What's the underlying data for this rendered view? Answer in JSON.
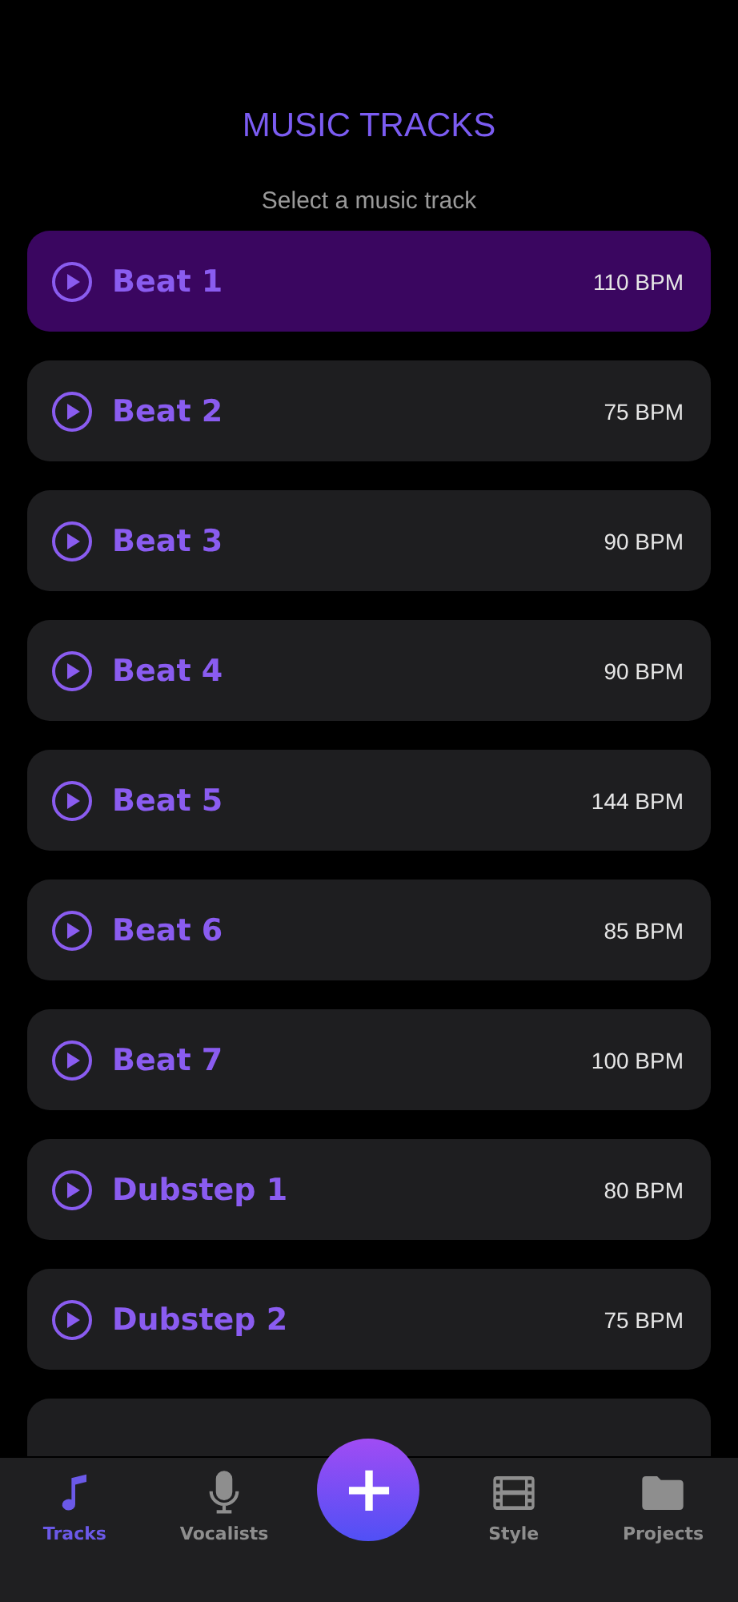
{
  "header": {
    "title": "MUSIC TRACKS",
    "subtitle": "Select a music track"
  },
  "tracks": [
    {
      "name": "Beat 1",
      "bpm": "110 BPM",
      "selected": true
    },
    {
      "name": "Beat 2",
      "bpm": "75 BPM",
      "selected": false
    },
    {
      "name": "Beat 3",
      "bpm": "90 BPM",
      "selected": false
    },
    {
      "name": "Beat 4",
      "bpm": "90 BPM",
      "selected": false
    },
    {
      "name": "Beat 5",
      "bpm": "144 BPM",
      "selected": false
    },
    {
      "name": "Beat 6",
      "bpm": "85 BPM",
      "selected": false
    },
    {
      "name": "Beat 7",
      "bpm": "100 BPM",
      "selected": false
    },
    {
      "name": "Dubstep 1",
      "bpm": "80 BPM",
      "selected": false
    },
    {
      "name": "Dubstep 2",
      "bpm": "75 BPM",
      "selected": false
    }
  ],
  "tab_bar": [
    {
      "kind": "tracks",
      "label": "Tracks",
      "selected": true
    },
    {
      "kind": "vocalists",
      "label": "Vocalists",
      "selected": false
    },
    {
      "kind": "add",
      "label": "+"
    },
    {
      "kind": "style",
      "label": "Style",
      "selected": false
    },
    {
      "kind": "projects",
      "label": "Projects",
      "selected": false
    }
  ]
}
